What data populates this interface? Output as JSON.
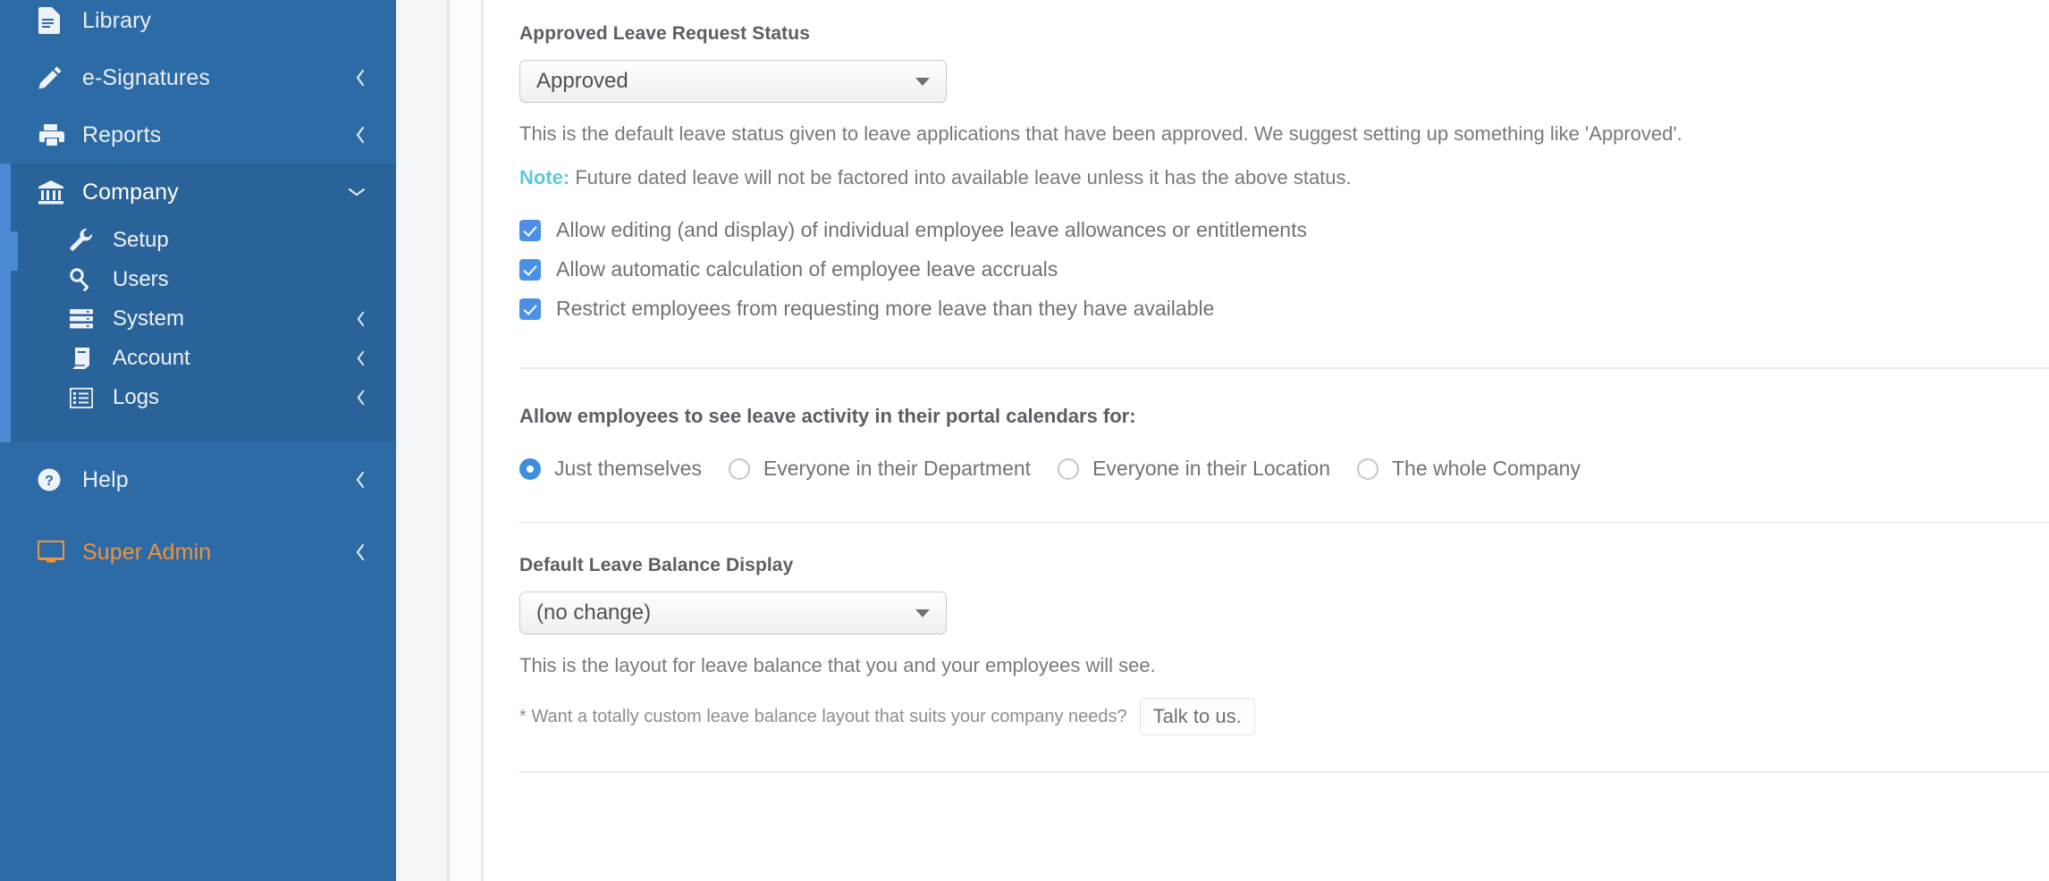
{
  "sidebar": {
    "items": [
      {
        "label": "Library",
        "icon": "document-icon",
        "chevron": null
      },
      {
        "label": "e-Signatures",
        "icon": "pencil-icon",
        "chevron": "chevron-left-icon"
      },
      {
        "label": "Reports",
        "icon": "printer-icon",
        "chevron": "chevron-left-icon"
      }
    ],
    "group": {
      "label": "Company",
      "icon": "bank-icon",
      "chevron": "chevron-down-icon",
      "sub_items": [
        {
          "label": "Setup",
          "icon": "wrench-icon",
          "chevron": null,
          "active": true
        },
        {
          "label": "Users",
          "icon": "key-icon",
          "chevron": null,
          "active": false
        },
        {
          "label": "System",
          "icon": "server-icon",
          "chevron": "chevron-left-icon",
          "active": false
        },
        {
          "label": "Account",
          "icon": "book-icon",
          "chevron": "chevron-left-icon",
          "active": false
        },
        {
          "label": "Logs",
          "icon": "list-icon",
          "chevron": "chevron-left-icon",
          "active": false
        }
      ]
    },
    "footer_items": [
      {
        "label": "Help",
        "icon": "question-circle-icon",
        "chevron": "chevron-left-icon",
        "highlight": false
      },
      {
        "label": "Super Admin",
        "icon": "monitor-icon",
        "chevron": "chevron-left-icon",
        "highlight": true
      }
    ],
    "colors": {
      "background": "#2d6ba6",
      "group_background": "#2a6399",
      "accent_bar": "#4a8ad4",
      "super_admin_text": "#f0923a"
    }
  },
  "main": {
    "leave_status": {
      "label": "Approved Leave Request Status",
      "select_value": "Approved",
      "select_caret": "caret-down-icon",
      "helper": "This is the default leave status given to leave applications that have been approved. We suggest setting up something like 'Approved'.",
      "note_keyword": "Note:",
      "note_text": " Future dated leave will not be factored into available leave unless it has the above status.",
      "note_color": "#5ec8dc",
      "checkboxes": [
        {
          "label": "Allow editing (and display) of individual employee leave allowances or entitlements",
          "checked": true
        },
        {
          "label": "Allow automatic calculation of employee leave accruals",
          "checked": true
        },
        {
          "label": "Restrict employees from requesting more leave than they have available",
          "checked": true
        }
      ],
      "checkbox_color": "#4a90e6"
    },
    "calendar_visibility": {
      "heading": "Allow employees to see leave activity in their portal calendars for:",
      "options": [
        {
          "label": "Just themselves",
          "selected": true
        },
        {
          "label": "Everyone in their Department",
          "selected": false
        },
        {
          "label": "Everyone in their Location",
          "selected": false
        },
        {
          "label": "The whole Company",
          "selected": false
        }
      ],
      "radio_color": "#3e8ee0"
    },
    "balance_display": {
      "label": "Default Leave Balance Display",
      "select_value": "(no change)",
      "select_caret": "caret-down-icon",
      "helper": "This is the layout for leave balance that you and your employees will see.",
      "fineprint": "* Want a totally custom leave balance layout that suits your company needs?",
      "cta_label": "Talk to us."
    }
  }
}
